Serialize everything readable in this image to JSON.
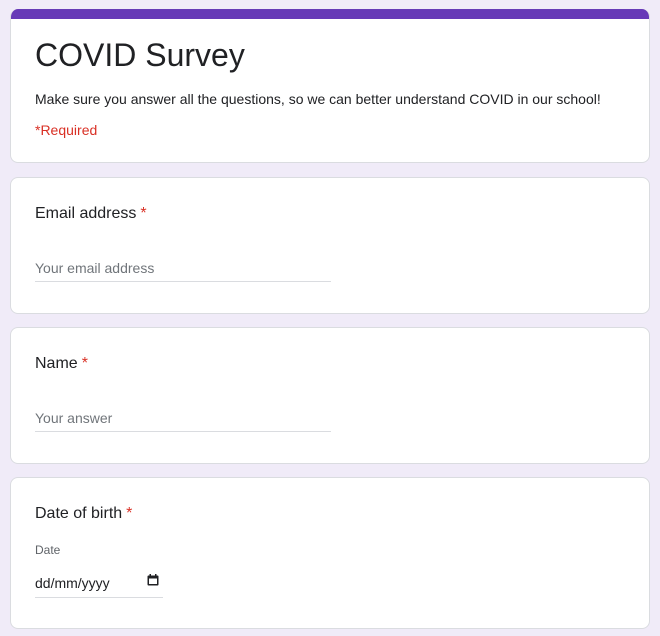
{
  "form": {
    "accent_color": "#673ab7",
    "background_color": "#f0ebf8",
    "required_color": "#d93025",
    "title": "COVID Survey",
    "description": "Make sure you answer all the questions, so we can better understand COVID in our school!",
    "required_note": "*Required"
  },
  "questions": {
    "email": {
      "title": "Email address",
      "required_mark": "*",
      "placeholder": "Your email address",
      "value": ""
    },
    "name": {
      "title": "Name",
      "required_mark": "*",
      "placeholder": "Your answer",
      "value": ""
    },
    "dob": {
      "title": "Date of birth",
      "required_mark": "*",
      "sublabel": "Date",
      "value": "dd/mm/yyyy",
      "icon": "calendar-icon"
    }
  }
}
